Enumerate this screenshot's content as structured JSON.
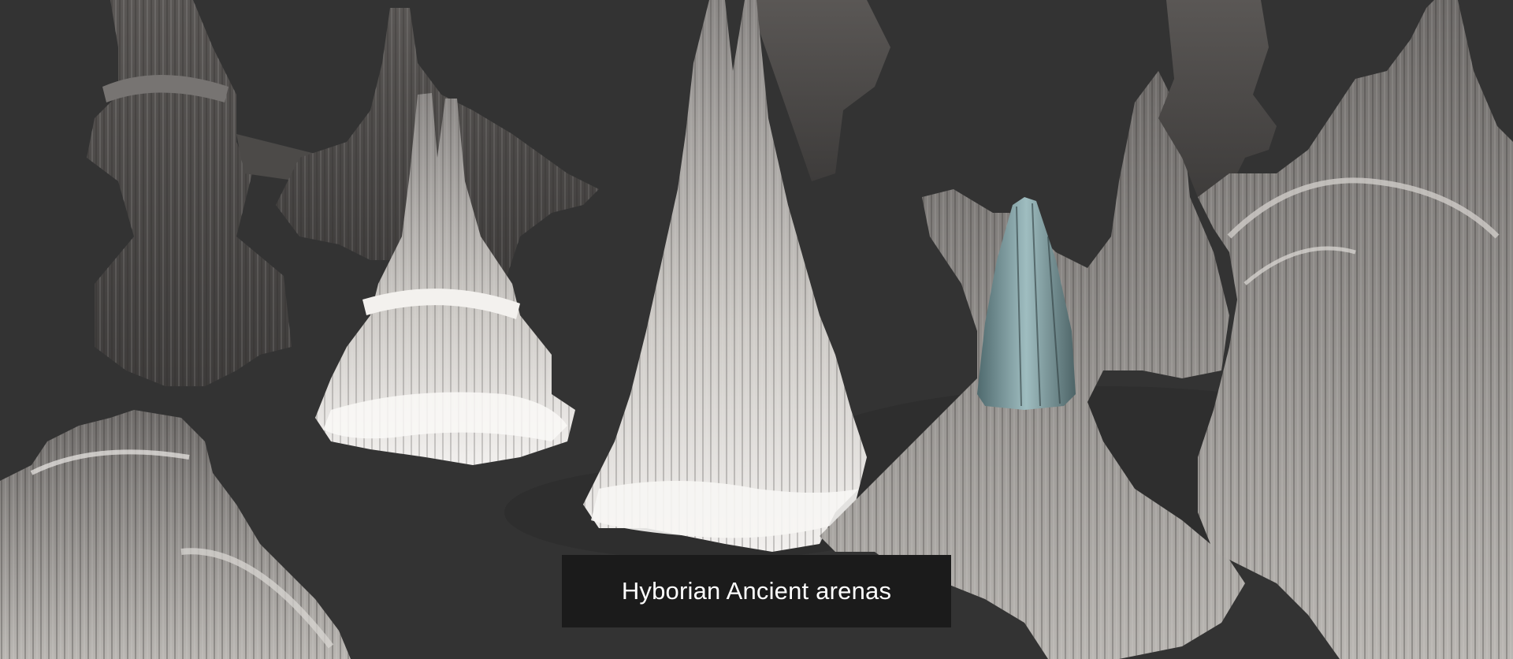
{
  "scene": {
    "caption": "Hyborian Ancient arenas",
    "colors": {
      "background": "#333333",
      "stone_light": "#e8e6e3",
      "stone_mid": "#9a9896",
      "stone_dark": "#4a4846",
      "glass": "#6f8f93",
      "caption_bg": "#1b1b1b",
      "caption_text": "#ffffff"
    },
    "structures": [
      "dark-tower-back-left",
      "dark-tower-back-center",
      "white-peak-tower-left",
      "tall-spire-tower-center",
      "glass-dome-tower-right",
      "arched-complex-far-right",
      "arena-bridge-bottom-left"
    ]
  }
}
